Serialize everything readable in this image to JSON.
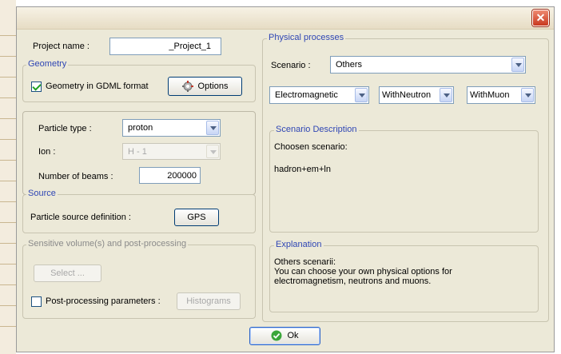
{
  "window": {
    "close_glyph": "✕"
  },
  "project": {
    "label": "Project name :",
    "value": "_Project_1"
  },
  "geometry": {
    "title": "Geometry",
    "gdml_label": "Geometry in GDML format",
    "gdml_checked": true,
    "options_label": "Options"
  },
  "particle": {
    "type_label": "Particle type :",
    "type_value": "proton",
    "ion_label": "Ion :",
    "ion_value": "H - 1",
    "beams_label": "Number of beams :",
    "beams_value": "200000"
  },
  "source": {
    "title": "Source",
    "definition_label": "Particle source definition :",
    "gps_label": "GPS"
  },
  "sensitive": {
    "title": "Sensitive volume(s) and post-processing",
    "select_label": "Select ...",
    "postproc_label": "Post-processing parameters :",
    "postproc_checked": false,
    "histograms_label": "Histograms"
  },
  "physical": {
    "title": "Physical processes",
    "scenario_label": "Scenario :",
    "scenario_value": "Others",
    "em_value": "Electromagnetic",
    "neutron_value": "WithNeutron",
    "muon_value": "WithMuon"
  },
  "scenario_description": {
    "title": "Scenario Description",
    "line1": "Choosen scenario:",
    "line2": "hadron+em+ln"
  },
  "explanation": {
    "title": "Explanation",
    "line1": "Others scenarii:",
    "line2": "You can choose your own physical options for",
    "line3": "electromagnetism, neutrons and muons."
  },
  "ok": {
    "label": "Ok"
  }
}
